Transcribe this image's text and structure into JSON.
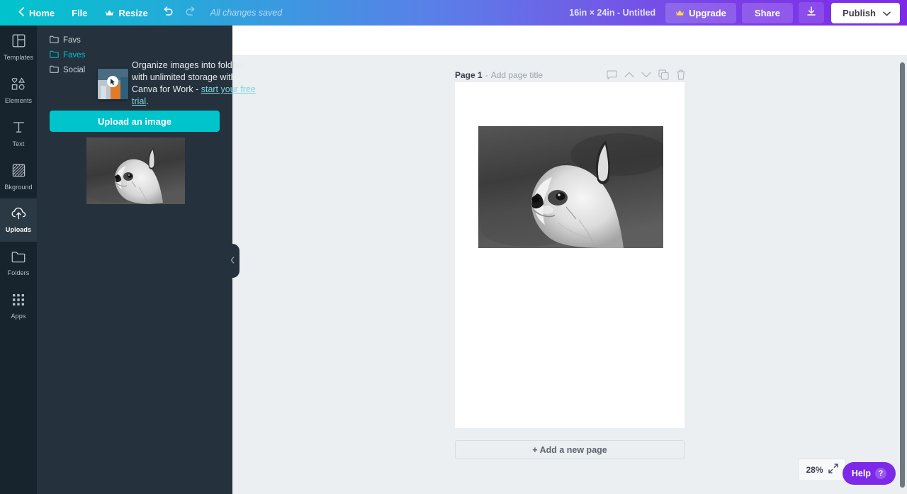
{
  "topbar": {
    "back_icon": "chevron-left-icon",
    "home": "Home",
    "file": "File",
    "resize": "Resize",
    "resize_icon": "crown-icon",
    "undo_icon": "undo-arrow-icon",
    "redo_icon": "redo-arrow-icon",
    "save_status": "All changes saved",
    "doc_dimensions": "16in × 24in - Untitled",
    "upgrade": "Upgrade",
    "upgrade_icon": "crown-icon",
    "share": "Share",
    "download_icon": "download-icon",
    "publish": "Publish",
    "publish_caret": "chevron-down-icon",
    "gradient_start": "#00c4cc",
    "gradient_end": "#7d2ae8"
  },
  "rail": {
    "items": [
      {
        "label": "Templates",
        "icon": "templates-grid-icon",
        "active": false
      },
      {
        "label": "Elements",
        "icon": "elements-shapes-icon",
        "active": false
      },
      {
        "label": "Text",
        "icon": "text-t-icon",
        "active": false
      },
      {
        "label": "Bkground",
        "icon": "background-hatch-icon",
        "active": false
      },
      {
        "label": "Uploads",
        "icon": "upload-cloud-icon",
        "active": true
      },
      {
        "label": "Folders",
        "icon": "folder-icon",
        "active": false
      },
      {
        "label": "Apps",
        "icon": "apps-dots-icon",
        "active": false
      }
    ]
  },
  "panel": {
    "folders": [
      {
        "label": "Favs",
        "icon": "folder-icon",
        "highlighted": false
      },
      {
        "label": "Faves",
        "icon": "folder-icon",
        "highlighted": true
      },
      {
        "label": "Social",
        "icon": "folder-icon",
        "highlighted": false
      }
    ],
    "tip_text_before": "Organize images into folders with unlimited storage with Canva for Work - ",
    "tip_link": "start your free trial",
    "tip_text_after": ".",
    "upload_button": "Upload an image",
    "upload_button_color": "#00c4cc",
    "thumbnail_alt": "french-bulldog-bw-photo",
    "drag_ghost_alt": "dragged-image-thumbnail",
    "collapse_icon": "chevron-left-icon",
    "background_color": "#25313d"
  },
  "editor": {
    "page_label": "Page 1",
    "page_separator": "-",
    "page_title_placeholder": "Add page title",
    "tools": [
      {
        "name": "comment-icon",
        "glyph": "comment"
      },
      {
        "name": "move-page-up-icon",
        "glyph": "chevron-up"
      },
      {
        "name": "move-page-down-icon",
        "glyph": "chevron-down"
      },
      {
        "name": "duplicate-page-icon",
        "glyph": "copy"
      },
      {
        "name": "delete-page-icon",
        "glyph": "trash"
      }
    ],
    "add_page_button": "+ Add a new page",
    "canvas_image_alt": "french-bulldog-bw-photo-on-canvas",
    "canvas_background": "#ffffff",
    "workspace_background": "#eceff1"
  },
  "footer": {
    "zoom_level": "28%",
    "fit_icon": "expand-arrows-icon",
    "help_label": "Help",
    "help_icon": "question-mark-icon",
    "help_color": "#7d2ae8"
  }
}
